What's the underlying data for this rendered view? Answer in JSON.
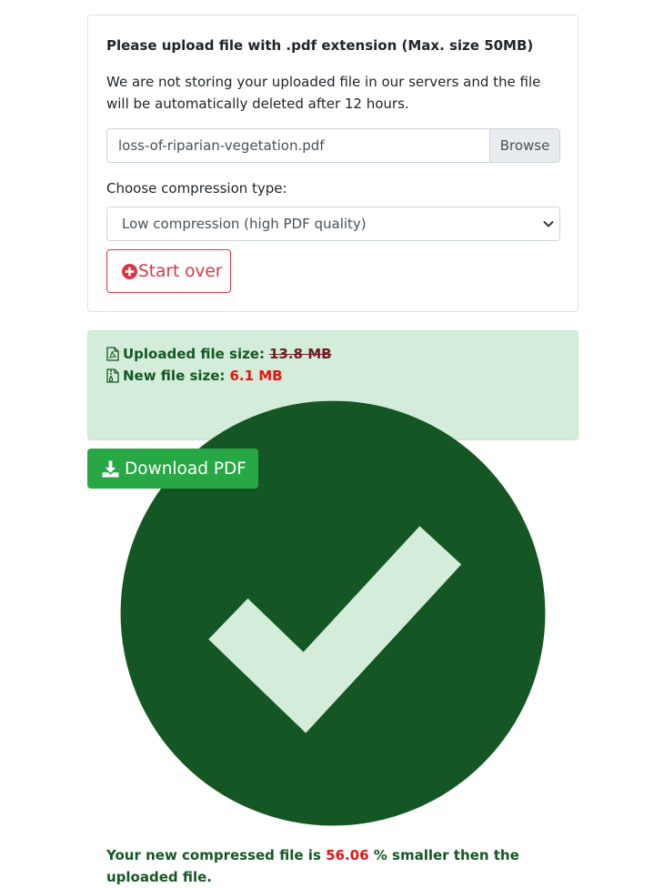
{
  "upload_card": {
    "title": "Please upload file with .pdf extension (Max. size 50MB)",
    "description": "We are not storing your uploaded file in our servers and the file will be automatically deleted after 12 hours.",
    "file_input": {
      "filename": "loss-of-riparian-vegetation.pdf",
      "browse_label": "Browse"
    },
    "compression": {
      "label": "Choose compression type:",
      "selected": "Low compression (high PDF quality)"
    },
    "start_over_label": "Start over"
  },
  "result_alert": {
    "uploaded_label": "Uploaded file size:",
    "uploaded_value": "13.8 MB",
    "new_label": "New file size:",
    "new_value": "6.1 MB",
    "summary_prefix": "Your new compressed file is",
    "summary_percent": "56.06",
    "summary_suffix": "% smaller then the uploaded",
    "summary_end": "file."
  },
  "download_label": "Download PDF",
  "icons": {
    "uploaded": "file-pdf-icon",
    "new": "file-archive-icon",
    "summary": "check-circle-icon",
    "start_over": "plus-circle-icon",
    "download": "download-icon",
    "select": "chevron-down-icon"
  },
  "colors": {
    "danger": "#dc3545",
    "success": "#28a745",
    "alert_bg": "#d4edda",
    "alert_text": "#155724",
    "highlight": "#e81313"
  }
}
